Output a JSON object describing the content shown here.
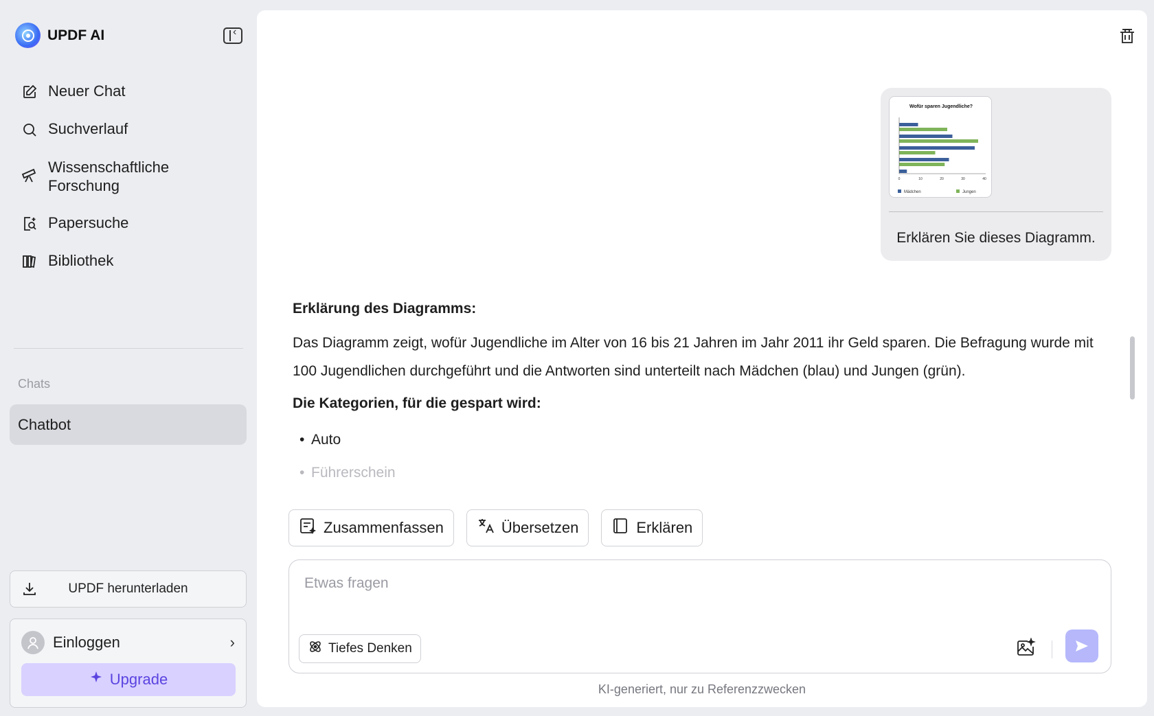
{
  "brand": {
    "name": "UPDF AI"
  },
  "nav": {
    "items": [
      {
        "label": "Neuer Chat",
        "icon": "edit-icon"
      },
      {
        "label": "Suchverlauf",
        "icon": "search-icon"
      },
      {
        "label_line1": "Wissenschaftliche",
        "label_line2": "Forschung",
        "icon": "telescope-icon"
      },
      {
        "label": "Papersuche",
        "icon": "paper-search-icon"
      },
      {
        "label": "Bibliothek",
        "icon": "library-icon"
      }
    ]
  },
  "chats": {
    "section_label": "Chats",
    "items": [
      {
        "label": "Chatbot"
      }
    ]
  },
  "sidebar_footer": {
    "download_label": "UPDF herunterladen",
    "login_label": "Einloggen",
    "upgrade_label": "Upgrade"
  },
  "conversation": {
    "user_message": {
      "text": "Erklären Sie dieses Diagramm.",
      "attachment": {
        "title": "Wofür sparen Jugendliche?",
        "legend": [
          "Mädchen",
          "Jungen"
        ],
        "x_ticks": [
          "0",
          "10",
          "20",
          "30",
          "40"
        ]
      }
    },
    "answer": {
      "heading": "Erklärung des Diagramms:",
      "paragraph": "Das Diagramm zeigt, wofür Jugendliche im Alter von 16 bis 21 Jahren im Jahr 2011 ihr Geld sparen. Die Befragung wurde mit 100 Jugendlichen durchgeführt und die Antworten sind unterteilt nach Mädchen (blau) und Jungen (grün).",
      "subheading": "Die Kategorien, für die gespart wird:",
      "list": [
        "Auto",
        "Führerschein"
      ]
    }
  },
  "quick_actions": [
    {
      "label": "Zusammenfassen",
      "icon": "summarize-icon"
    },
    {
      "label": "Übersetzen",
      "icon": "translate-icon"
    },
    {
      "label": "Erklären",
      "icon": "book-icon"
    }
  ],
  "composer": {
    "placeholder": "Etwas fragen",
    "deep_thinking_label": "Tiefes Denken"
  },
  "footnote": "KI-generiert, nur zu Referenzzwecken",
  "colors": {
    "accent": "#5a44e0",
    "upgrade_bg": "#d9d1ff",
    "send_bg": "#b6b8fb",
    "girls_series": "#3b5f9a",
    "boys_series": "#7fb45a"
  }
}
